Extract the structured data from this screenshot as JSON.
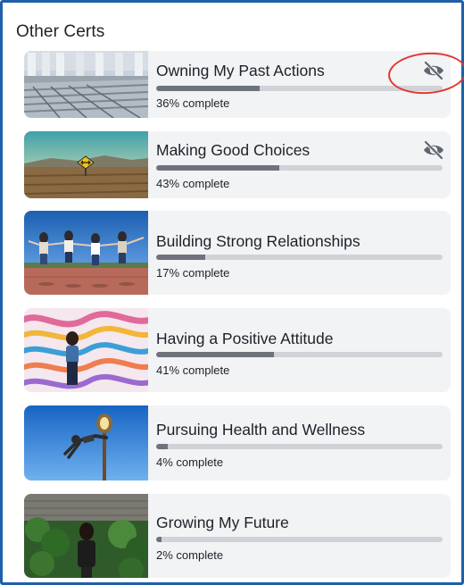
{
  "section": {
    "title": "Other Certs"
  },
  "certs": [
    {
      "title": "Owning My Past Actions",
      "progress": 36,
      "progress_text": "36% complete",
      "hidden_toggle": true,
      "image": "building-columns-photo"
    },
    {
      "title": "Making Good Choices",
      "progress": 43,
      "progress_text": "43% complete",
      "hidden_toggle": true,
      "image": "desert-road-sign-photo"
    },
    {
      "title": "Building Strong Relationships",
      "progress": 17,
      "progress_text": "17% complete",
      "hidden_toggle": false,
      "image": "friends-jumping-photo"
    },
    {
      "title": "Having a Positive Attitude",
      "progress": 41,
      "progress_text": "41% complete",
      "hidden_toggle": false,
      "image": "woman-mural-photo"
    },
    {
      "title": "Pursuing Health and Wellness",
      "progress": 4,
      "progress_text": "4% complete",
      "hidden_toggle": false,
      "image": "lamp-post-jump-photo"
    },
    {
      "title": "Growing My Future",
      "progress": 2,
      "progress_text": "2% complete",
      "hidden_toggle": false,
      "image": "woman-garden-photo"
    }
  ],
  "colors": {
    "frame": "#1f5fa8",
    "card_bg": "#f1f3f5",
    "bar_track": "#cfd3d8",
    "bar_fill": "#6e737b",
    "annotation": "#e2382f"
  }
}
